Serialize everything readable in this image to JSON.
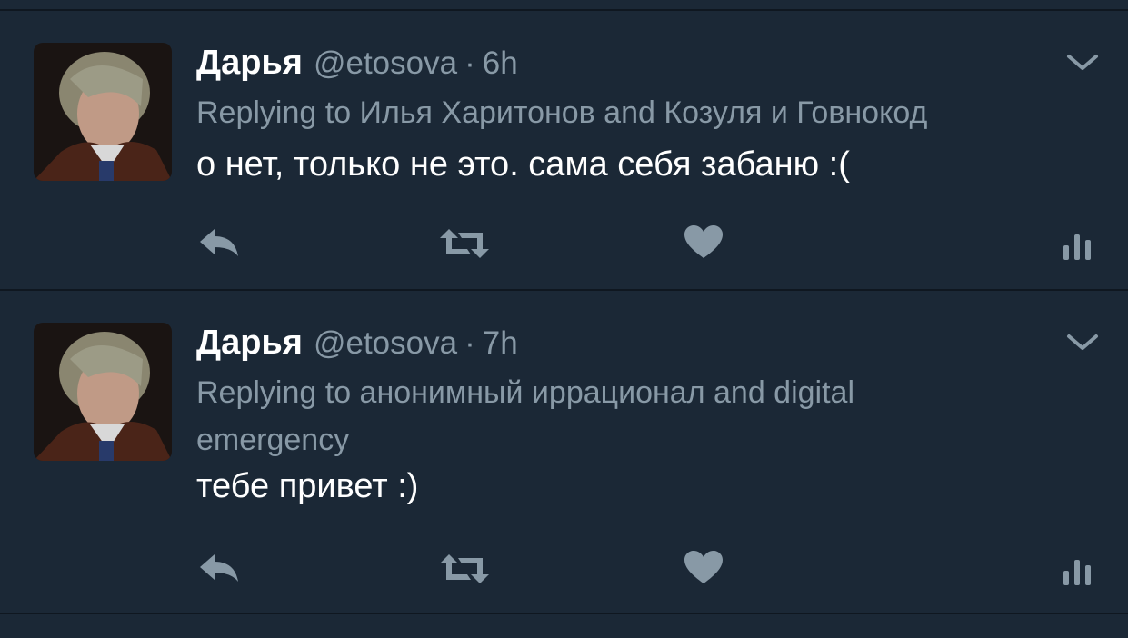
{
  "tweets": [
    {
      "name": "Дарья",
      "handle": "@etosova",
      "separator": "·",
      "time": "6h",
      "replying": "Replying to Илья Харитонов and Козуля и Говнокод",
      "text": "о нет, только не это. сама себя забаню :("
    },
    {
      "name": "Дарья",
      "handle": "@etosova",
      "separator": "·",
      "time": "7h",
      "replying": "Replying to анонимный иррационал and digital emergency",
      "text": "тебе привет :)"
    }
  ],
  "icons": {
    "reply": "reply-icon",
    "retweet": "retweet-icon",
    "like": "heart-icon",
    "analytics": "analytics-icon",
    "menu": "chevron-down-icon"
  },
  "colors": {
    "background": "#1b2836",
    "divider": "#0f1720",
    "text_primary": "#ffffff",
    "text_secondary": "#8899a6",
    "icon": "#8899a6"
  }
}
